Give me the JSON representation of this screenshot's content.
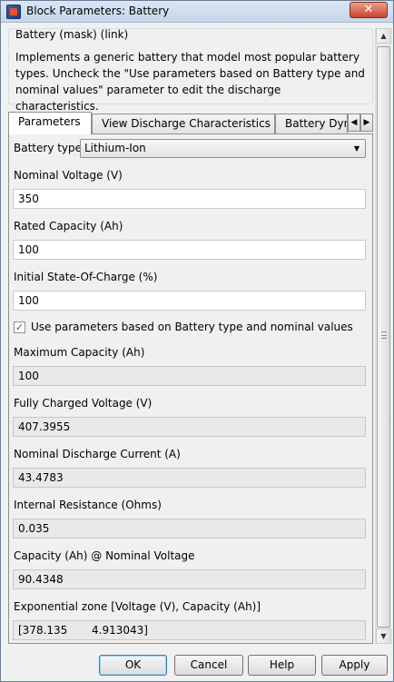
{
  "window": {
    "title": "Block Parameters: Battery",
    "close_glyph": "✕"
  },
  "mask": {
    "label": "Battery (mask) (link)",
    "description": "Implements a generic battery that model most popular battery types. Uncheck the \"Use parameters based on Battery type and nominal values\" parameter to edit the discharge characteristics."
  },
  "tabs": [
    {
      "label": "Parameters",
      "active": true
    },
    {
      "label": "View Discharge Characteristics",
      "active": false
    },
    {
      "label": "Battery Dyn",
      "active": false
    }
  ],
  "tab_scroll": {
    "left_glyph": "◀",
    "right_glyph": "▶"
  },
  "params": {
    "battery_type_label": "Battery type",
    "battery_type_value": "Lithium-Ion",
    "nominal_voltage_label": "Nominal Voltage (V)",
    "nominal_voltage_value": "350",
    "rated_capacity_label": "Rated Capacity (Ah)",
    "rated_capacity_value": "100",
    "initial_soc_label": "Initial State-Of-Charge (%)",
    "initial_soc_value": "100",
    "use_params_label": "Use parameters based on Battery type and nominal values",
    "use_params_checked": true,
    "max_capacity_label": "Maximum Capacity (Ah)",
    "max_capacity_value": "100",
    "fully_charged_label": "Fully Charged Voltage (V)",
    "fully_charged_value": "407.3955",
    "nominal_discharge_label": "Nominal Discharge Current (A)",
    "nominal_discharge_value": "43.4783",
    "internal_resistance_label": "Internal Resistance (Ohms)",
    "internal_resistance_value": "0.035",
    "capacity_nominal_label": "Capacity (Ah) @ Nominal Voltage",
    "capacity_nominal_value": "90.4348",
    "exp_zone_label": "Exponential zone [Voltage (V), Capacity (Ah)]",
    "exp_zone_value": "[378.135       4.913043]"
  },
  "buttons": {
    "ok": "OK",
    "cancel": "Cancel",
    "help": "Help",
    "apply": "Apply"
  },
  "icons": {
    "check": "✓",
    "caret": "▼",
    "scroll_up": "▲",
    "scroll_down": "▼"
  }
}
